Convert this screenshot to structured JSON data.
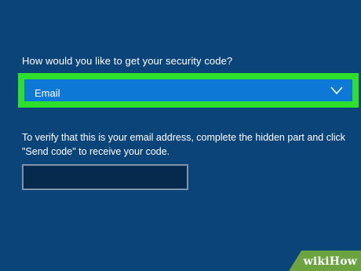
{
  "security_code": {
    "question": "How would you like to get your security code?",
    "method_select": {
      "selected": "Email"
    },
    "instructions": "To verify that this is your email address, complete the hidden part and click \"Send code\" to receive your code.",
    "email_input": {
      "value": "",
      "placeholder": ""
    }
  },
  "watermark": {
    "text": "wikiHow"
  },
  "colors": {
    "background": "#0b4479",
    "select_background": "#0d78d6",
    "highlight": "#2fe02b",
    "input_background": "#052a4e",
    "watermark": "#6aa33f"
  },
  "icons": {
    "select_arrow": "chevron-down-icon"
  }
}
